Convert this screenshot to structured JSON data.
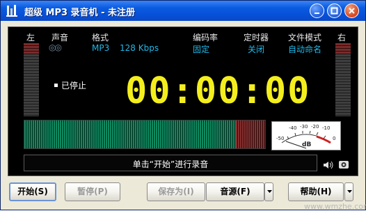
{
  "window": {
    "title": "超级 MP3 录音机 - 未注册",
    "controls": [
      "minimize",
      "maximize",
      "close"
    ]
  },
  "display": {
    "left_label": "左",
    "right_label": "右",
    "settings": [
      {
        "label": "声音",
        "value": "◎◎"
      },
      {
        "label": "格式",
        "value": "MP3"
      },
      {
        "label": "",
        "value": "128 Kbps"
      },
      {
        "label": "编码率",
        "value": "固定"
      },
      {
        "label": "定时器",
        "value": "关闭"
      },
      {
        "label": "文件模式",
        "value": "自动命名"
      }
    ],
    "status": "已停止",
    "timer": "00:00:00",
    "dial_scale": [
      "-40",
      "-30",
      "-20",
      "-10",
      "-50",
      "0",
      "dB"
    ],
    "hint": "单击“开始”进行录音"
  },
  "buttons": {
    "start": "开始(S)",
    "pause": "暂停(P)",
    "save_as": "保存为(I)",
    "source": "音源(F)",
    "help": "帮助(H)"
  },
  "watermark": "www.wmzhe.com",
  "colors": {
    "title_bar": "#0a5ce0",
    "display_bg": "#000000",
    "timer": "#f4ef1c",
    "setting_value": "#20b8e8",
    "meter_green": "#0f8a60"
  }
}
